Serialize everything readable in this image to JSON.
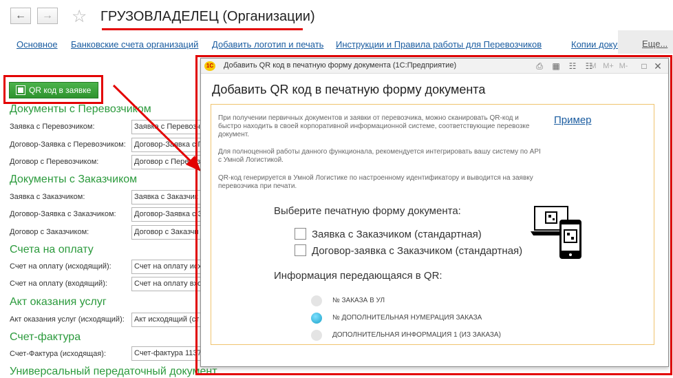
{
  "header": {
    "back_icon": "arrow-left-icon",
    "forward_icon": "arrow-right-icon",
    "favorite_icon": "star-icon",
    "title": "ГРУЗОВЛАДЕЛЕЦ (Организации)"
  },
  "tabs": [
    {
      "label": "Основное"
    },
    {
      "label": "Банковские счета организаций"
    },
    {
      "label": "Добавить логотип и печать"
    },
    {
      "label": "Инструкции и Правила работы для Перевозчиков"
    },
    {
      "label": "Копии документов"
    },
    {
      "label": "Еще..."
    }
  ],
  "qr_button": {
    "label": "QR код в заявке"
  },
  "sections": [
    {
      "title": "Документы с Перевозчиком",
      "fields": [
        {
          "label": "Заявка с Перевозчиком:",
          "value": "Заявка с Перевозч"
        },
        {
          "label": "Договор-Заявка с Перевозчиком:",
          "value": "Договор-Заявка с П"
        },
        {
          "label": "Договор с Перевозчиком:",
          "value": "Договор с Перевоз"
        }
      ]
    },
    {
      "title": "Документы с Заказчиком",
      "fields": [
        {
          "label": "Заявка с Заказчиком:",
          "value": "Заявка с Заказчик"
        },
        {
          "label": "Договор-Заявка с Заказчиком:",
          "value": "Договор-Заявка с З"
        },
        {
          "label": "Договор с Заказчиком:",
          "value": "Договор с Заказчи"
        }
      ]
    },
    {
      "title": "Счета на оплату",
      "fields": [
        {
          "label": "Счет на оплату (исходящий):",
          "value": "Счет на оплату исх"
        },
        {
          "label": "Счет на оплату (входящий):",
          "value": "Счет на оплату вхо"
        }
      ]
    },
    {
      "title": "Акт оказания услуг",
      "fields": [
        {
          "label": "Акт оказания услуг (исходящий):",
          "value": "Акт исходящий (ст"
        }
      ]
    },
    {
      "title": "Счет-фактура",
      "fields": [
        {
          "label": "Счет-Фактура (исходящая):",
          "value": "Счет-фактура 1137"
        }
      ]
    },
    {
      "title": "Универсальный передаточный документ",
      "fields": []
    }
  ],
  "dialog": {
    "window_title": "Добавить QR код в печатную форму документа  (1С:Предприятие)",
    "logo_text": "1C",
    "toolbar_icons": [
      "print-icon",
      "table-icon",
      "calendar-icon",
      "calculator-icon"
    ],
    "memory_buttons": [
      "M",
      "M+",
      "M-"
    ],
    "maximize_icon": "maximize-icon",
    "close_icon": "close-icon",
    "heading": "Добавить QR код в печатную форму документа",
    "info": [
      "При получении первичных документов и заявки от перевозчика, можно сканировать QR-код и быстро находить в своей корпоративной информационной системе, соответствующие перевозке документ.",
      "Для полноценной работы данного функционала, рекомендуется интегрировать вашу систему по API с Умной Логистикой.",
      "QR-код генерируется в Умной Логистике по настроенному идентификатору и выводится на заявку перевозчика при печати."
    ],
    "example_link": "Пример",
    "select_title": "Выберите печатную форму документа:",
    "print_forms": [
      {
        "label": "Заявка с Заказчиком (стандартная)",
        "checked": false
      },
      {
        "label": "Договор-заявка с Заказчиком (стандартная)",
        "checked": false
      }
    ],
    "qr_info_title": "Информация передающаяся в QR:",
    "qr_options": [
      {
        "label": "№ ЗАКАЗА В УЛ",
        "selected": false
      },
      {
        "label": "№ ДОПОЛНИТЕЛЬНАЯ НУМЕРАЦИЯ ЗАКАЗА",
        "selected": true
      },
      {
        "label": "ДОПОЛНИТЕЛЬНАЯ ИНФОРМАЦИЯ 1 (ИЗ ЗАКАЗА)",
        "selected": false
      }
    ],
    "illustration_icon": "qr-devices-icon"
  },
  "colors": {
    "accent_green": "#2b9a3c",
    "link_blue": "#1a5ca0",
    "highlight_red": "#e30000",
    "panel_border": "#f0c36d"
  }
}
